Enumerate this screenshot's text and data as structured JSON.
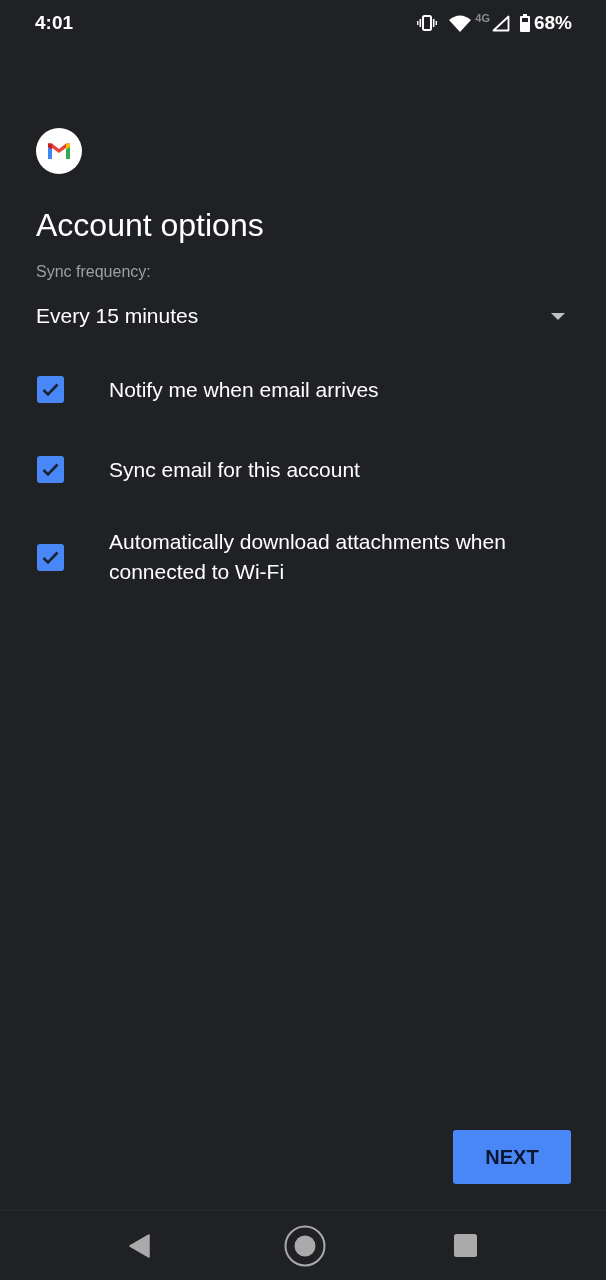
{
  "status_bar": {
    "time": "4:01",
    "network": "4G",
    "battery": "68%"
  },
  "header": {
    "title": "Account options"
  },
  "sync_frequency": {
    "label": "Sync frequency:",
    "value": "Every 15 minutes"
  },
  "options": [
    {
      "label": "Notify me when email arrives",
      "checked": true
    },
    {
      "label": "Sync email for this account",
      "checked": true
    },
    {
      "label": "Automatically download attachments when connected to Wi-Fi",
      "checked": true
    }
  ],
  "next_button": {
    "label": "NEXT"
  }
}
